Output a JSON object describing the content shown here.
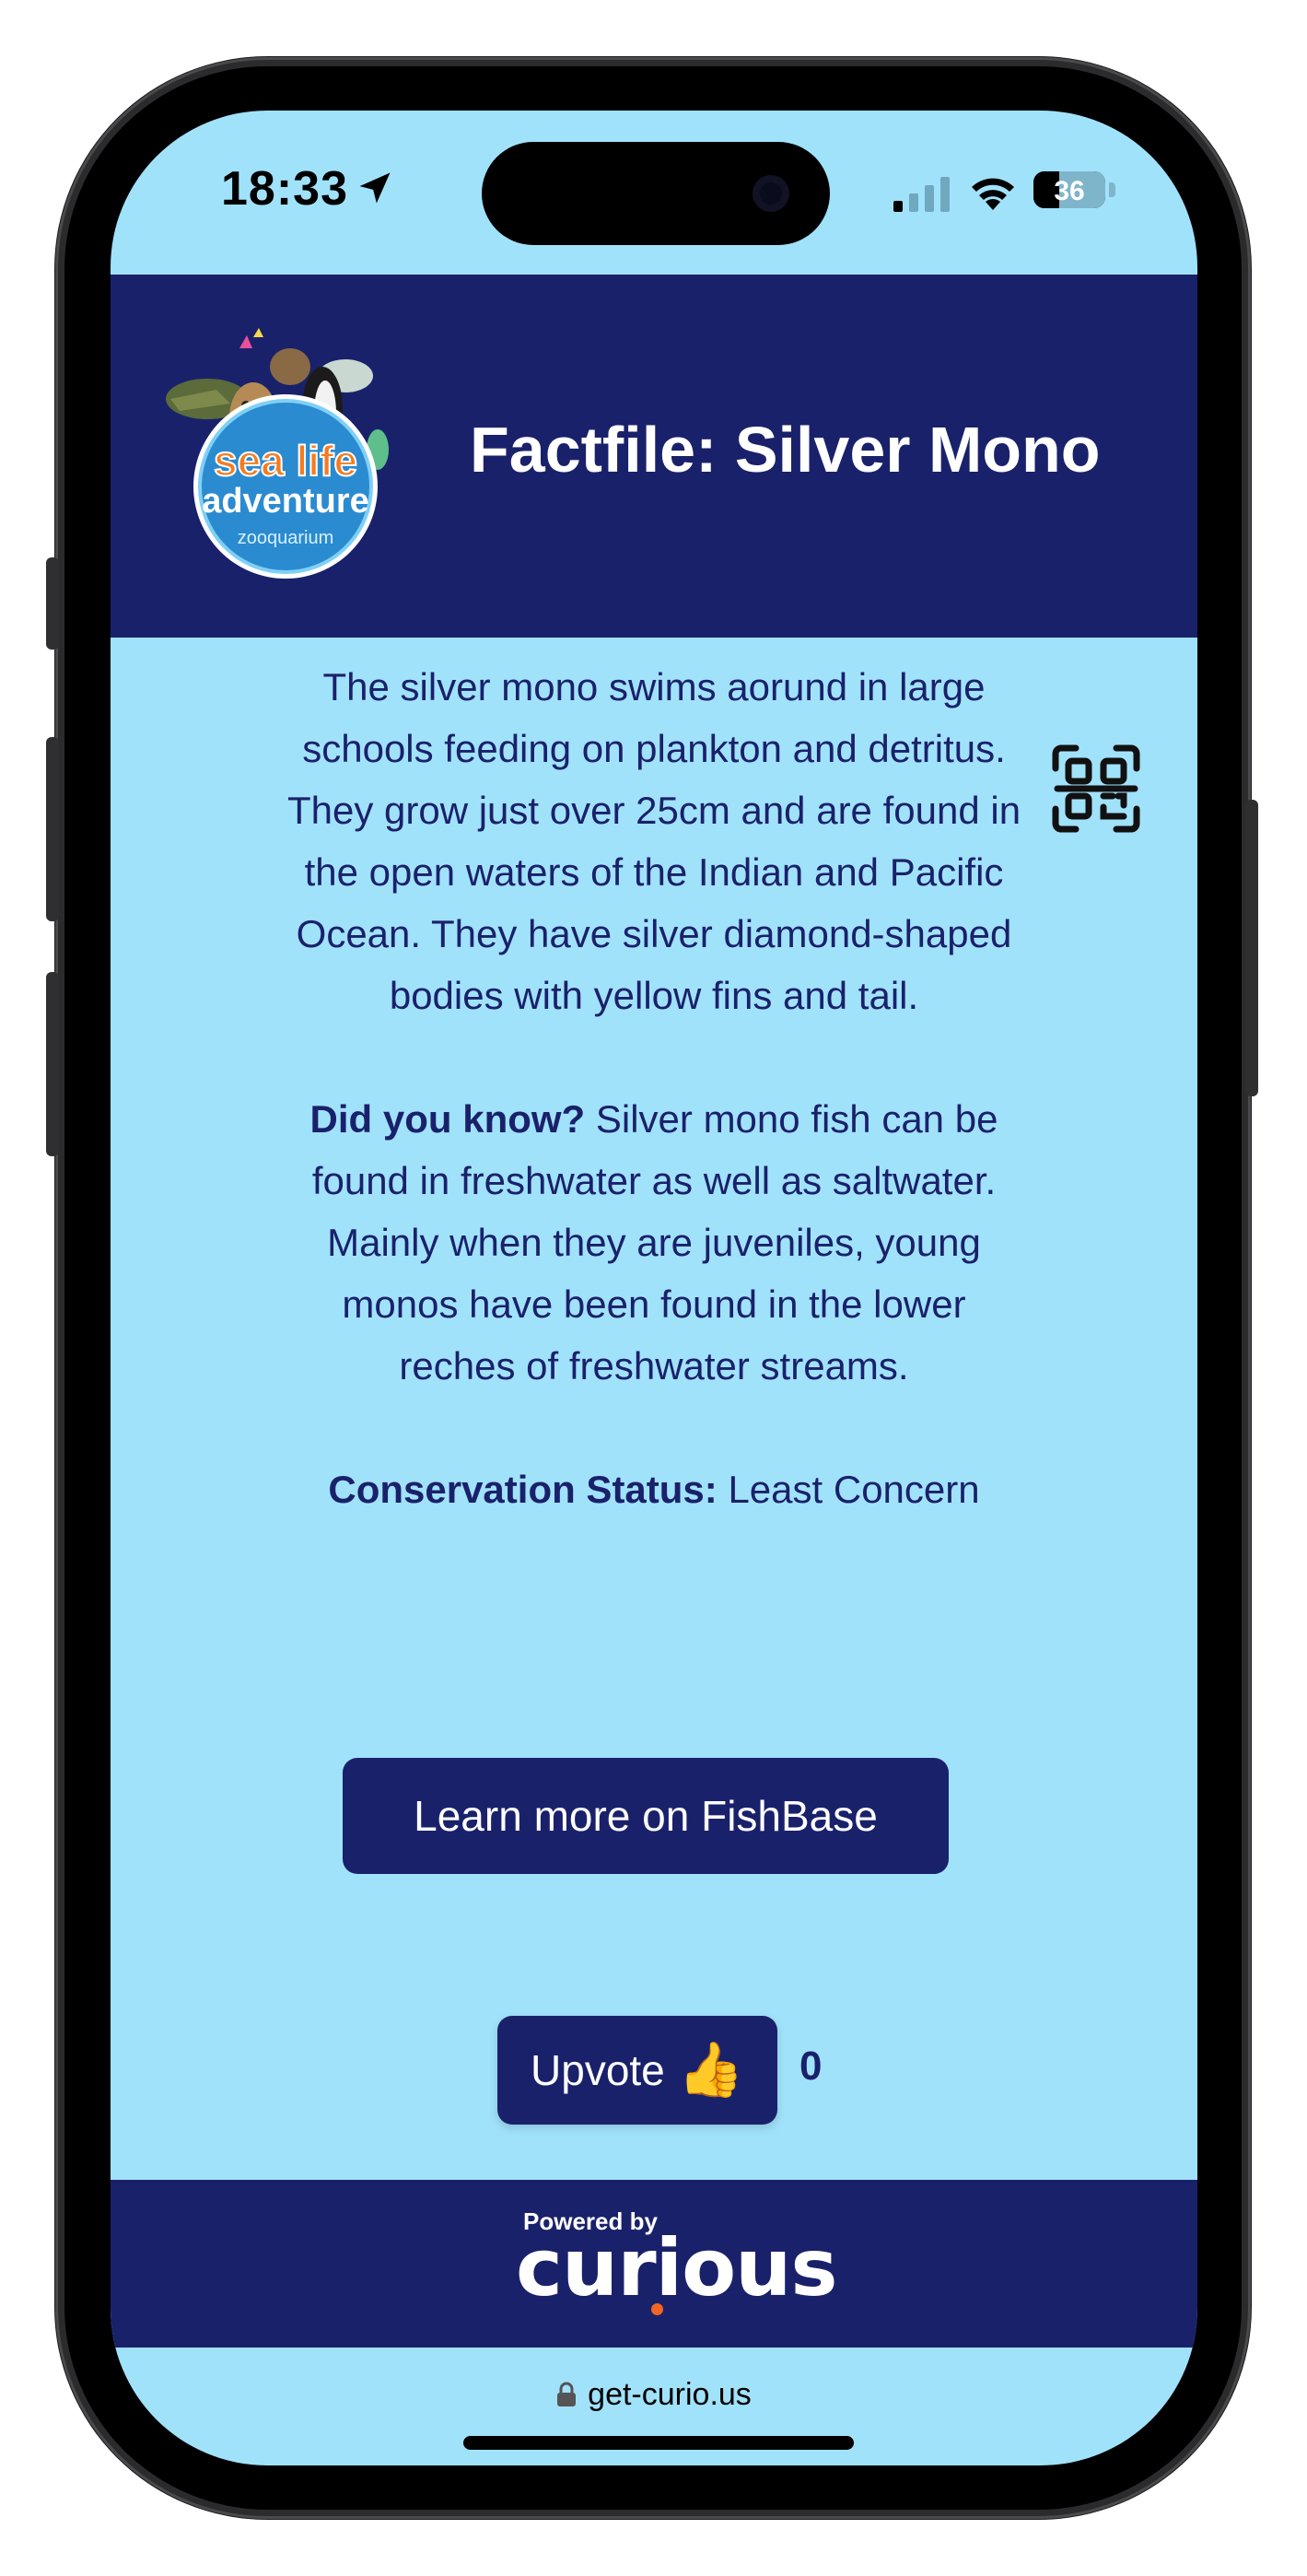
{
  "status_bar": {
    "time": "18:33",
    "battery_level": "36",
    "battery_fraction": 0.36
  },
  "header": {
    "title": "Factfile: Silver Mono",
    "logo": {
      "line1": "sea life",
      "line2": "adventure",
      "line3": "zooquarium"
    }
  },
  "content": {
    "description": "The silver mono swims aorund in large schools feeding on plankton and detritus. They grow just over 25cm and are found in the open waters of the Indian and Pacific Ocean. They have silver diamond-shaped bodies with yellow fins and tail.",
    "did_you_know_label": "Did you know?",
    "did_you_know_text": "Silver mono fish can be found in freshwater as well as saltwater. Mainly when they are juveniles, young monos have been found in the lower reches of freshwater streams.",
    "conservation_label": "Conservation Status:",
    "conservation_value": "Least Concern"
  },
  "actions": {
    "fishbase_label": "Learn more on FishBase",
    "upvote_label": "Upvote",
    "upvote_emoji": "👍",
    "upvote_count": "0"
  },
  "footer": {
    "powered_by": "Powered by",
    "brand": "curious"
  },
  "browser": {
    "url": "get-curio.us"
  },
  "colors": {
    "navy": "#1a216b",
    "light_blue": "#a1e2fb",
    "accent_orange": "#f26522"
  },
  "icons": [
    "location-arrow-icon",
    "cellular-signal-icon",
    "wifi-icon",
    "battery-icon",
    "qr-code-icon",
    "thumbs-up-icon",
    "lock-icon"
  ]
}
